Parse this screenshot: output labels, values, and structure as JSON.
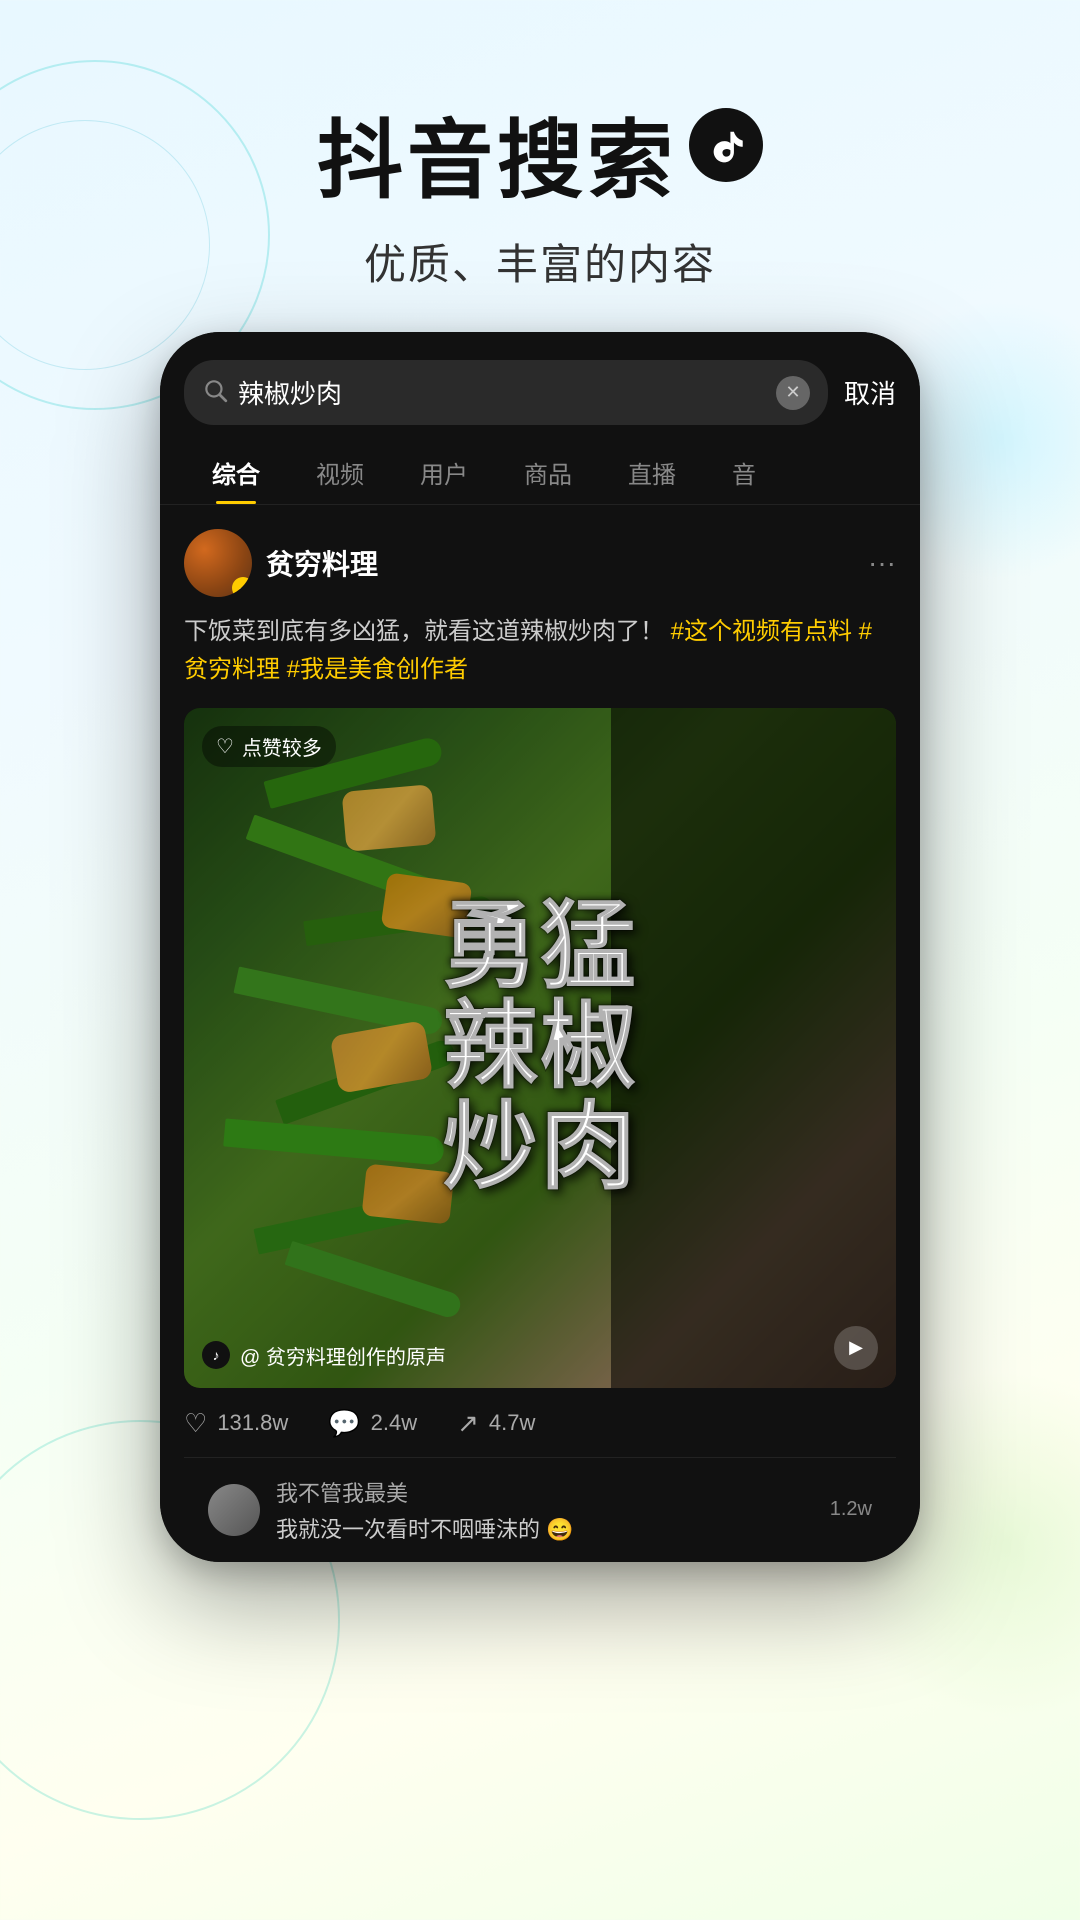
{
  "header": {
    "title": "抖音搜索",
    "tiktok_icon_label": "tiktok-logo",
    "subtitle": "优质、丰富的内容"
  },
  "phone": {
    "search": {
      "placeholder": "辣椒炒肉",
      "cancel_label": "取消"
    },
    "tabs": [
      {
        "label": "综合",
        "active": true
      },
      {
        "label": "视频",
        "active": false
      },
      {
        "label": "用户",
        "active": false
      },
      {
        "label": "商品",
        "active": false
      },
      {
        "label": "直播",
        "active": false
      },
      {
        "label": "音",
        "active": false
      }
    ],
    "result": {
      "username": "贫穷料理",
      "verified": true,
      "post_text_plain": "下饭菜到底有多凶猛，就看这道辣椒炒肉了！",
      "post_text_hashtags": "#这个视频有点料 #贫穷料理 #我是美食创作者",
      "video_label": "勇\n猛\n辣\n椒\n炒\n肉",
      "likes_badge": "点赞较多",
      "audio_label": "@ 贫穷料理创作的原声",
      "engagement": {
        "likes": "131.8w",
        "comments": "2.4w",
        "shares": "4.7w"
      },
      "comment_preview": {
        "commenter_name": "我不管我最美",
        "comment_text": "我就没一次看时不咽唾沫的 😄",
        "count": "1.2w"
      }
    }
  }
}
